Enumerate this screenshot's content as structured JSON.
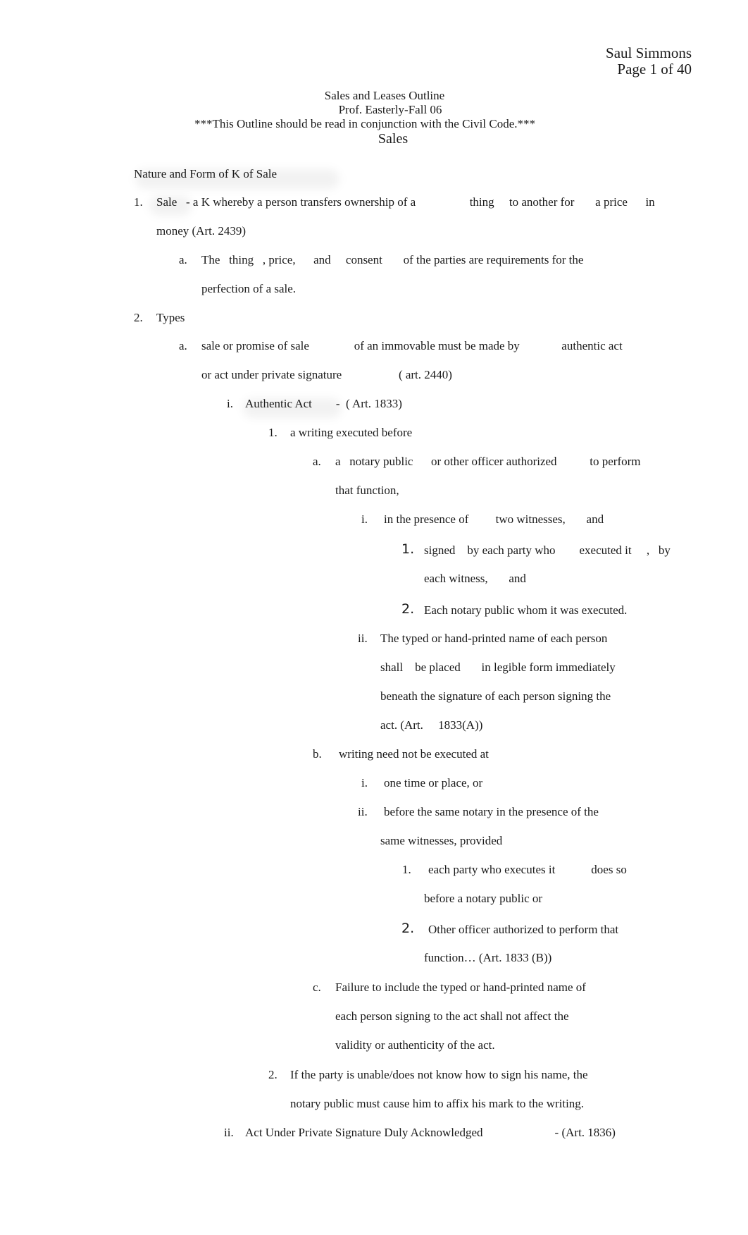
{
  "header": {
    "author": "Saul Simmons",
    "page_indicator": "Page 1 of 40"
  },
  "title_block": {
    "title": "Sales and Leases Outline",
    "professor": "Prof. Easterly-Fall 06",
    "note": "***This Outline should be read in conjunction with the Civil Code.***",
    "section": "Sales"
  },
  "outline": {
    "heading": "Nature and Form of K of Sale",
    "lines": [
      {
        "marker": "1.",
        "text": "Sale   - a K whereby a person transfers ownership of a                  thing     to another for       a price      in"
      },
      {
        "marker": "",
        "text": "money (Art. 2439)"
      },
      {
        "marker": "a.",
        "text": "The   thing   , price,      and     consent       of the parties are requirements for the"
      },
      {
        "marker": "",
        "text": "perfection of a sale."
      },
      {
        "marker": "2.",
        "text": "Types"
      },
      {
        "marker": "a.",
        "text": "sale or promise of sale               of an immovable must be made by              authentic act"
      },
      {
        "marker": "",
        "text": "or act under private signature                   ( art. 2440)"
      },
      {
        "marker": "i.",
        "text": "Authentic Act        -  ( Art. 1833)"
      },
      {
        "marker": "1.",
        "text": "a writing executed before"
      },
      {
        "marker": "a.",
        "text": "a   notary public      or other officer authorized           to perform"
      },
      {
        "marker": "",
        "text": "that function,"
      },
      {
        "marker": "i.",
        "text": "in the presence of         two witnesses,       and"
      },
      {
        "marker": "1.",
        "text": "signed    by each party who        executed it     ,   by"
      },
      {
        "marker": "",
        "text": "each witness,       and"
      },
      {
        "marker": "2.",
        "text": "Each notary public whom it was executed."
      },
      {
        "marker": "ii.",
        "text": "The typed or hand-printed name of each person"
      },
      {
        "marker": "",
        "text": "shall    be placed       in legible form immediately"
      },
      {
        "marker": "",
        "text": "beneath the signature of each person signing the"
      },
      {
        "marker": "",
        "text": "act. (Art.     1833(A))"
      },
      {
        "marker": "b.",
        "text": "writing need not be executed at"
      },
      {
        "marker": "i.",
        "text": "one time or place, or"
      },
      {
        "marker": "ii.",
        "text": "before the same notary in the presence of the"
      },
      {
        "marker": "",
        "text": "same witnesses, provided"
      },
      {
        "marker": "1.",
        "text": "each party who executes it            does so"
      },
      {
        "marker": "",
        "text": "before a notary public or"
      },
      {
        "marker": "2.",
        "text": "Other officer authorized to perform that"
      },
      {
        "marker": "",
        "text": "function… (Art. 1833 (B))"
      },
      {
        "marker": "c.",
        "text": "Failure to include the typed or hand-printed name of"
      },
      {
        "marker": "",
        "text": "each person signing to the act shall not affect the"
      },
      {
        "marker": "",
        "text": "validity or authenticity of the act."
      },
      {
        "marker": "2.",
        "text": "If the party is unable/does not know how to sign his name, the"
      },
      {
        "marker": "",
        "text": "notary public must cause him to affix his mark to the writing."
      },
      {
        "marker": "ii.",
        "text": "Act Under Private Signature Duly Acknowledged                        - (Art. 1836)"
      }
    ]
  }
}
